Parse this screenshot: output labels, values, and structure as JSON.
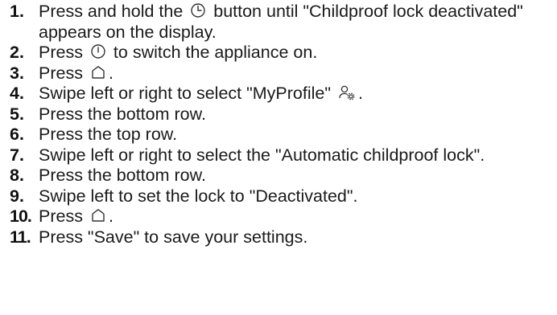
{
  "steps": [
    {
      "number": "1.",
      "before": "Press and hold the",
      "icon": "clock-icon",
      "after": "button until \"Childproof lock deactivated\" appears on the display."
    },
    {
      "number": "2.",
      "before": "Press",
      "icon": "power-icon",
      "after": "to switch the appliance on."
    },
    {
      "number": "3.",
      "before": "Press",
      "icon": "home-icon",
      "after": "."
    },
    {
      "number": "4.",
      "before": "Swipe left or right to select \"MyProfile\"",
      "icon": "user-settings-icon",
      "after": "."
    },
    {
      "number": "5.",
      "text": "Press the bottom row."
    },
    {
      "number": "6.",
      "text": "Press the top row."
    },
    {
      "number": "7.",
      "text": "Swipe left or right to select the \"Automatic childproof lock\"."
    },
    {
      "number": "8.",
      "text": "Press the bottom row."
    },
    {
      "number": "9.",
      "text": "Swipe left to set the lock to \"Deactivated\"."
    },
    {
      "number": "10.",
      "before": "Press",
      "icon": "home-icon",
      "after": "."
    },
    {
      "number": "11.",
      "text": "Press \"Save\" to save your settings."
    }
  ]
}
